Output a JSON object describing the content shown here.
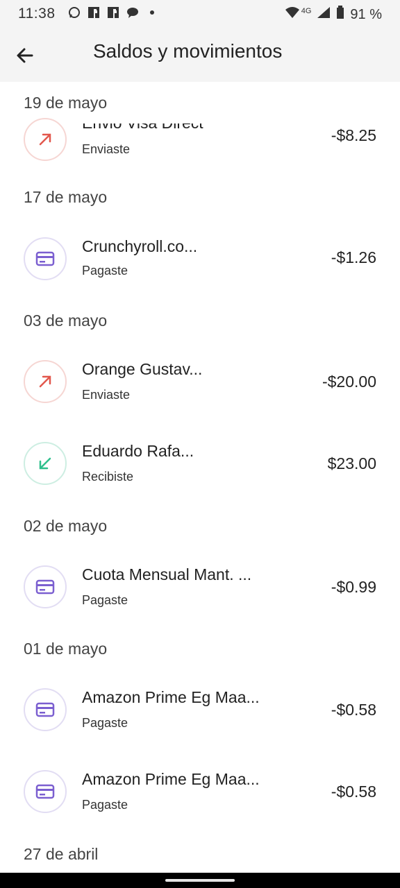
{
  "status_bar": {
    "time": "11:38",
    "network": "4G",
    "battery": "91 %",
    "left_icons": [
      "whatsapp-icon",
      "facebook-icon",
      "facebook-icon",
      "chat-bubble-icon",
      "dot-icon"
    ],
    "right_icons": [
      "wifi-icon",
      "signal-icon",
      "battery-icon"
    ]
  },
  "app_bar": {
    "title": "Saldos y movimientos",
    "back_icon": "arrow-left-icon"
  },
  "colors": {
    "sent": "#e2574c",
    "received": "#2ebf8c",
    "card": "#7b5fd0",
    "header_bg": "#f4f4f4"
  },
  "sections": [
    {
      "date": "19 de mayo",
      "items": [
        {
          "name": "Envio Visa Direct",
          "type": "Enviaste",
          "amount": "-$8.25",
          "icon": "sent"
        }
      ]
    },
    {
      "date": "17 de mayo",
      "items": [
        {
          "name": "Crunchyroll.co...",
          "type": "Pagaste",
          "amount": "-$1.26",
          "icon": "card"
        }
      ]
    },
    {
      "date": "03 de mayo",
      "items": [
        {
          "name": "Orange Gustav...",
          "type": "Enviaste",
          "amount": "-$20.00",
          "icon": "sent"
        },
        {
          "name": "Eduardo Rafa...",
          "type": "Recibiste",
          "amount": "$23.00",
          "icon": "received"
        }
      ]
    },
    {
      "date": "02 de mayo",
      "items": [
        {
          "name": "Cuota Mensual Mant. ...",
          "type": "Pagaste",
          "amount": "-$0.99",
          "icon": "card"
        }
      ]
    },
    {
      "date": "01 de mayo",
      "items": [
        {
          "name": "Amazon Prime Eg Maa...",
          "type": "Pagaste",
          "amount": "-$0.58",
          "icon": "card"
        },
        {
          "name": "Amazon Prime Eg Maa...",
          "type": "Pagaste",
          "amount": "-$0.58",
          "icon": "card"
        }
      ]
    },
    {
      "date": "27 de abril",
      "items": []
    }
  ]
}
